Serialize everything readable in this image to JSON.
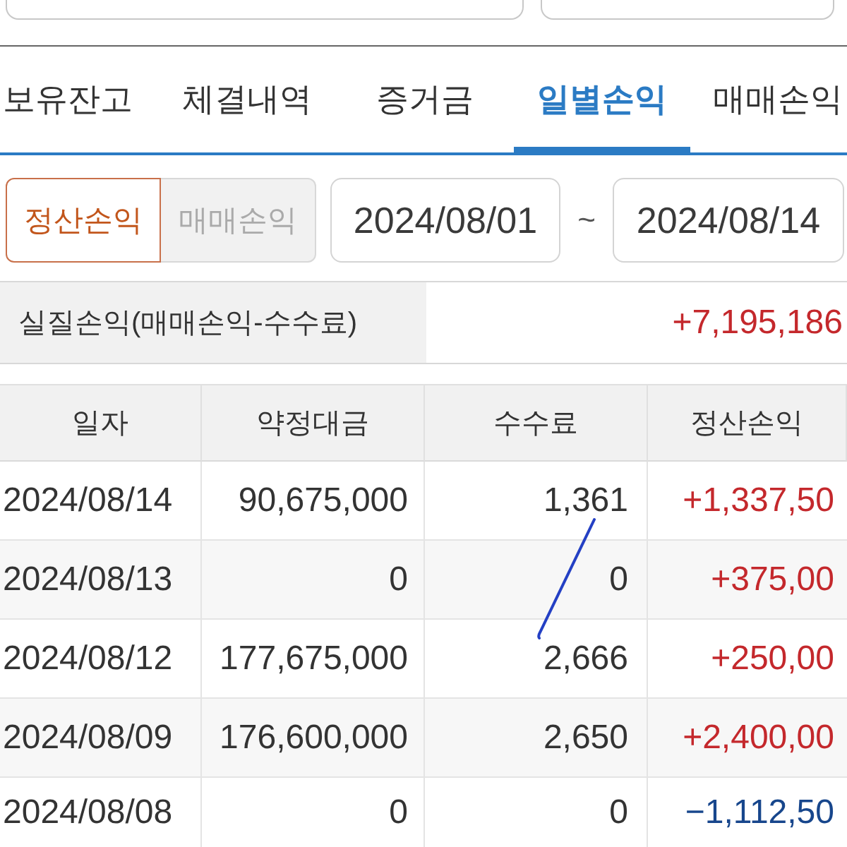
{
  "tabs": [
    {
      "label": "보유잔고",
      "selected": false
    },
    {
      "label": "체결내역",
      "selected": false
    },
    {
      "label": "증거금",
      "selected": false
    },
    {
      "label": "일별손익",
      "selected": true
    },
    {
      "label": "매매손익",
      "selected": false
    }
  ],
  "mode_toggle": [
    {
      "label": "정산손익",
      "selected": true
    },
    {
      "label": "매매손익",
      "selected": false
    }
  ],
  "date_range": {
    "from": "2024/08/01",
    "separator": "~",
    "to": "2024/08/14"
  },
  "summary": {
    "label": "실질손익(매매손익-수수료)",
    "value": "+7,195,186",
    "color": "#c4282c"
  },
  "table": {
    "columns": [
      "일자",
      "약정대금",
      "수수료",
      "정산손익"
    ],
    "rows": [
      {
        "date": "2024/08/14",
        "contract_amount": "90,675,000",
        "fee": "1,361",
        "settlement_pnl": "+1,337,50",
        "color": "#c4282c"
      },
      {
        "date": "2024/08/13",
        "contract_amount": "0",
        "fee": "0",
        "settlement_pnl": "+375,00",
        "color": "#c4282c"
      },
      {
        "date": "2024/08/12",
        "contract_amount": "177,675,000",
        "fee": "2,666",
        "settlement_pnl": "+250,00",
        "color": "#c4282c"
      },
      {
        "date": "2024/08/09",
        "contract_amount": "176,600,000",
        "fee": "2,650",
        "settlement_pnl": "+2,400,00",
        "color": "#c4282c"
      },
      {
        "date": "2024/08/08",
        "contract_amount": "0",
        "fee": "0",
        "settlement_pnl": "−1,112,50",
        "color": "#17468c"
      }
    ]
  }
}
